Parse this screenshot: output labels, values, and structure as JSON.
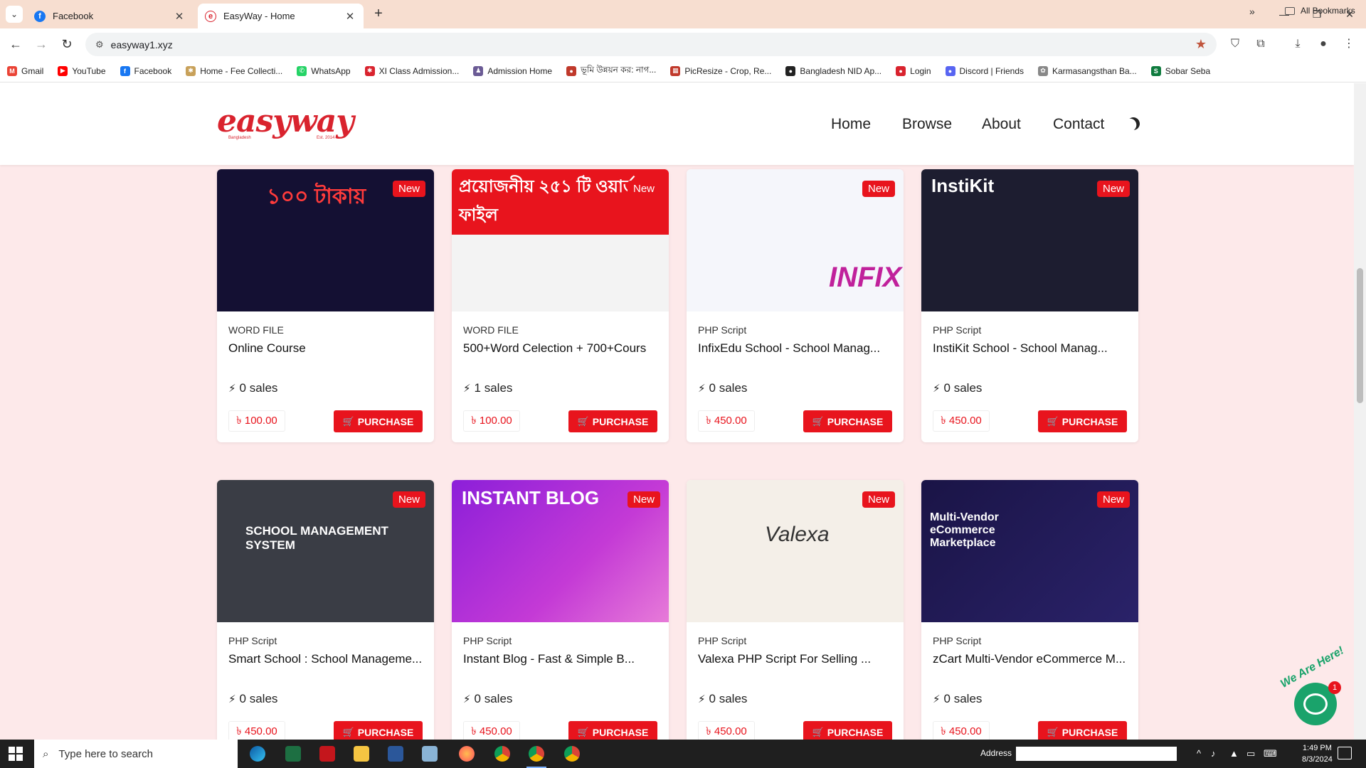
{
  "browser": {
    "tabs": [
      {
        "title": "Facebook",
        "active": false
      },
      {
        "title": "EasyWay - Home",
        "active": true
      }
    ],
    "url": "easyway1.xyz",
    "bookmarks": [
      {
        "label": "Gmail",
        "color": "#ea4335",
        "glyph": "M"
      },
      {
        "label": "YouTube",
        "color": "#ff0000",
        "glyph": "▶"
      },
      {
        "label": "Facebook",
        "color": "#1877f2",
        "glyph": "f"
      },
      {
        "label": "Home - Fee Collecti...",
        "color": "#c8a15a",
        "glyph": "✱"
      },
      {
        "label": "WhatsApp",
        "color": "#25d366",
        "glyph": "✆"
      },
      {
        "label": "XI Class Admission...",
        "color": "#d9232e",
        "glyph": "✱"
      },
      {
        "label": "Admission Home",
        "color": "#6b5b95",
        "glyph": "♟"
      },
      {
        "label": "ভূমি উন্নয়ন কর: নাগ...",
        "color": "#c0392b",
        "glyph": "●"
      },
      {
        "label": "PicResize - Crop, Re...",
        "color": "#c0392b",
        "glyph": "▦"
      },
      {
        "label": "Bangladesh NID Ap...",
        "color": "#222222",
        "glyph": "●"
      },
      {
        "label": "Login",
        "color": "#d9232e",
        "glyph": "●"
      },
      {
        "label": "Discord | Friends",
        "color": "#5865f2",
        "glyph": "●"
      },
      {
        "label": "Karmasangsthan Ba...",
        "color": "#888888",
        "glyph": "✿"
      },
      {
        "label": "Sobar Seba",
        "color": "#0f7b3e",
        "glyph": "S"
      }
    ],
    "all_bookmarks": "All Bookmarks"
  },
  "site": {
    "logo": {
      "word": "easyway",
      "tag": "Bangladesh",
      "est": "Est. 2014"
    },
    "nav": [
      "Home",
      "Browse",
      "About",
      "Contact"
    ],
    "accent": "#e8141d"
  },
  "products": [
    {
      "badge": "New",
      "category": "WORD FILE",
      "name": "Online Course",
      "sales": "0 sales",
      "price": "৳ 100.00",
      "button": "PURCHASE",
      "thumb_text": "১০০ টাকায়"
    },
    {
      "badge": "New",
      "category": "WORD FILE",
      "name": "500+Word Celection + 700+Cours",
      "sales": "1 sales",
      "price": "৳ 100.00",
      "button": "PURCHASE",
      "thumb_text": "প্রয়োজনীয় ২৫১ টি ওয়ার্ড ফাইল"
    },
    {
      "badge": "New",
      "category": "PHP Script",
      "name": "InfixEdu School - School Manag...",
      "sales": "0 sales",
      "price": "৳ 450.00",
      "button": "PURCHASE",
      "thumb_text": "INFIX"
    },
    {
      "badge": "New",
      "category": "PHP Script",
      "name": "InstiKit School - School Manag...",
      "sales": "0 sales",
      "price": "৳ 450.00",
      "button": "PURCHASE",
      "thumb_text": "InstiKit"
    },
    {
      "badge": "New",
      "category": "PHP Script",
      "name": "Smart School : School Manageme...",
      "sales": "0 sales",
      "price": "৳ 450.00",
      "button": "PURCHASE",
      "thumb_text": "SCHOOL MANAGEMENT SYSTEM"
    },
    {
      "badge": "New",
      "category": "PHP Script",
      "name": "Instant Blog - Fast & Simple B...",
      "sales": "0 sales",
      "price": "৳ 450.00",
      "button": "PURCHASE",
      "thumb_text": "INSTANT BLOG"
    },
    {
      "badge": "New",
      "category": "PHP Script",
      "name": "Valexa PHP Script For Selling ...",
      "sales": "0 sales",
      "price": "৳ 450.00",
      "button": "PURCHASE",
      "thumb_text": "Valexa"
    },
    {
      "badge": "New",
      "category": "PHP Script",
      "name": "zCart Multi-Vendor eCommerce M...",
      "sales": "0 sales",
      "price": "৳ 450.00",
      "button": "PURCHASE",
      "thumb_text": "Multi-Vendor eCommerce Marketplace"
    }
  ],
  "chat": {
    "text": "We Are Here!",
    "count": "1"
  },
  "taskbar": {
    "search_placeholder": "Type here to search",
    "address_label": "Address",
    "time": "1:49 PM",
    "date": "8/3/2024"
  }
}
